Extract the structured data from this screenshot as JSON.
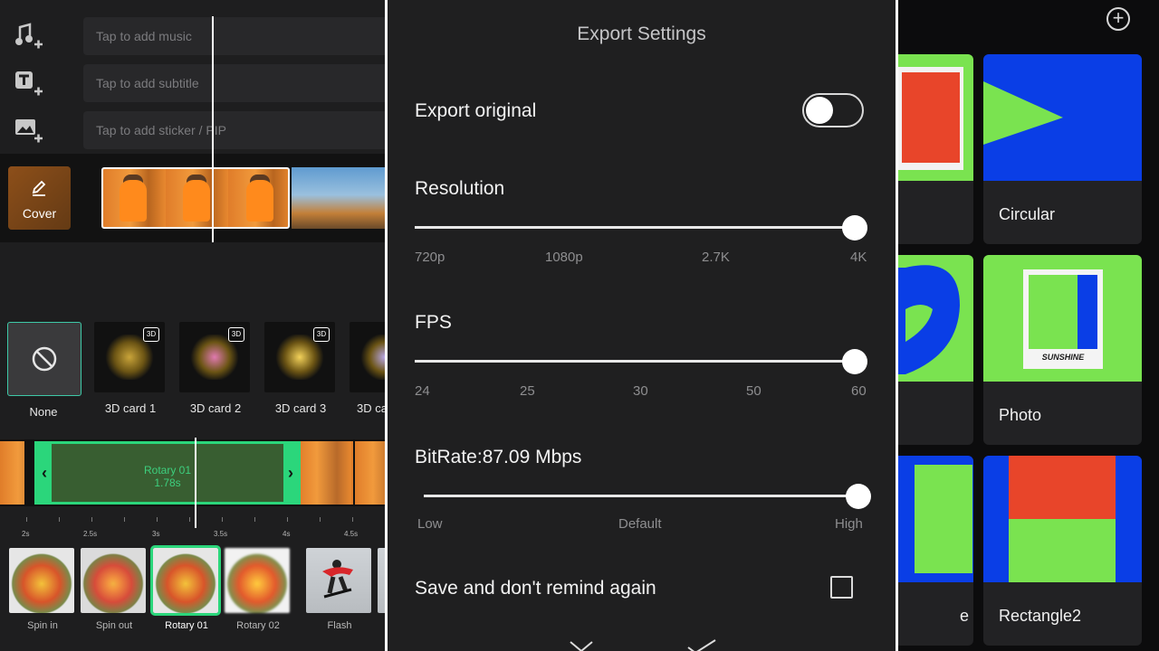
{
  "left": {
    "add_music": "Tap to add music",
    "add_subtitle": "Tap to add subtitle",
    "add_sticker": "Tap to add sticker / PIP",
    "cover_label": "Cover",
    "effects": [
      {
        "label": "None"
      },
      {
        "label": "3D card 1"
      },
      {
        "label": "3D card 2"
      },
      {
        "label": "3D card 3"
      },
      {
        "label": "3D ca"
      }
    ],
    "badge_3d": "3D",
    "transition_name": "Rotary 01",
    "transition_duration": "1.78s",
    "ruler_ticks": [
      "2s",
      "2.5s",
      "3s",
      "3.5s",
      "4s",
      "4.5s"
    ],
    "transitions": [
      {
        "label": "Spin in"
      },
      {
        "label": "Spin out"
      },
      {
        "label": "Rotary 01",
        "selected": true
      },
      {
        "label": "Rotary 02"
      },
      {
        "label": "Flash"
      }
    ]
  },
  "center": {
    "title": "Export Settings",
    "export_original_label": "Export original",
    "export_original_on": false,
    "resolution_label": "Resolution",
    "resolution_ticks": [
      "720p",
      "1080p",
      "2.7K",
      "4K"
    ],
    "resolution_value": "4K",
    "fps_label": "FPS",
    "fps_ticks": [
      "24",
      "25",
      "30",
      "50",
      "60"
    ],
    "fps_value": "60",
    "bitrate_label": "BitRate:87.09 Mbps",
    "bitrate_ticks": [
      "Low",
      "Default",
      "High"
    ],
    "bitrate_level": 1.0,
    "save_remind_label": "Save and don't remind again",
    "save_remind_checked": false
  },
  "right": {
    "cards": [
      {
        "name": ""
      },
      {
        "name": "Circular"
      },
      {
        "name": ""
      },
      {
        "name": "Photo"
      },
      {
        "name": "e"
      },
      {
        "name": "Rectangle2"
      }
    ],
    "sunshine_text": "SUNSHINE"
  },
  "colors": {
    "accent_green": "#2bd67b",
    "teal_select": "#3ec9a7",
    "mask_green": "#7ae350",
    "mask_blue": "#0a3ee6",
    "mask_red": "#e8452a"
  }
}
